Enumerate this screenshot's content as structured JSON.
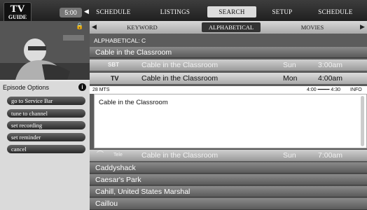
{
  "header": {
    "logo_top": "TV",
    "logo_bottom": "GUIDE",
    "clock": "5:00",
    "nav": [
      "SCHEDULE",
      "LISTINGS",
      "SEARCH",
      "SETUP",
      "SCHEDULE"
    ],
    "active_nav": "SEARCH"
  },
  "subtabs": {
    "items": [
      "KEYWORD",
      "ALPHABETICAL",
      "MOVIES"
    ],
    "active": "ALPHABETICAL"
  },
  "options": {
    "title": "Episode Options",
    "buttons": [
      "go to Service Bar",
      "tune to channel",
      "set recording",
      "set reminder",
      "cancel"
    ]
  },
  "list": {
    "heading": "ALPHABETICAL: C",
    "first_title": "Cable in the Classroom",
    "airings": [
      {
        "channel": "SBT",
        "title": "Cable in the Classroom",
        "day": "Sun",
        "time": "3:00am"
      },
      {
        "channel": "TV",
        "title": "Cable in the Classroom",
        "day": "Mon",
        "time": "4:00am"
      }
    ],
    "detail_bar": {
      "left": "28 MTS",
      "range": "4:00 ━━━━ 4:30",
      "right": "INFO"
    },
    "detail_text": "Cable in the Classroom",
    "next_airing": {
      "channel": "Tele",
      "title": "Cable in the Classroom",
      "day": "Sun",
      "time": "7:00am"
    },
    "titles": [
      "Caddyshack",
      "Caesar's Park",
      "Cahill, United States Marshal",
      "Caillou"
    ]
  }
}
